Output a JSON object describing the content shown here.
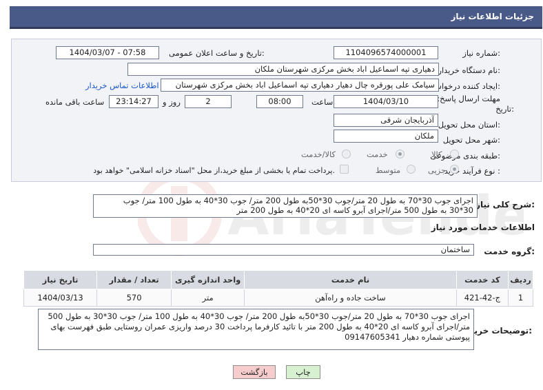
{
  "header": {
    "title": "جزئیات اطلاعات نیاز"
  },
  "form": {
    "need_number": {
      "label": "شماره نیاز:",
      "value": "1104096574000001"
    },
    "announce_datetime": {
      "label": "تاریخ و ساعت اعلان عمومی:",
      "value": "1404/03/07 - 07:58"
    },
    "buyer_org": {
      "label": "نام دستگاه خریدار:",
      "value": "دهیاری تپه اسماعیل اباد بخش مرکزی شهرستان ملکان"
    },
    "requester": {
      "label": "ایجاد کننده درخواست:",
      "value": "سیامک علی پورقره چال دهیار دهیاری تپه اسماعیل اباد بخش مرکزی شهرستان",
      "contact_link": "اطلاعات تماس خریدار"
    },
    "deadline": {
      "label_line1": "مهلت ارسال پاسخ: تا",
      "label_line2": "تاریخ:",
      "date": "1404/03/10",
      "time_label": "ساعت",
      "time": "08:00",
      "days": "2",
      "days_label": "روز و",
      "remaining": "23:14:27",
      "remaining_label": "ساعت باقی مانده"
    },
    "province": {
      "label": "استان محل تحویل:",
      "value": "آذربایجان شرقی"
    },
    "city": {
      "label": "شهر محل تحویل:",
      "value": "ملکان"
    },
    "category": {
      "label": "طبقه بندی موضوعی:",
      "options": [
        "کالا",
        "خدمت",
        "کالا/خدمت"
      ],
      "selected": "خدمت"
    },
    "purchase_type": {
      "label": "نوع فرآیند خرید :",
      "options": [
        "جزیی",
        "متوسط"
      ],
      "selected": "جزیی",
      "treasury_note": "پرداخت تمام یا بخشی از مبلغ خرید،از محل \"اسناد خزانه اسلامی\" خواهد بود."
    }
  },
  "general_description": {
    "label": "شرح کلی نیاز:",
    "text": "اجرای جوب 30*70 به طول 20 متر/جوب 30*50به طول 200 متر/ جوب 30*40 به طول 100 متر/ جوب 30*30 به طول 500 متر/اجرای آبرو کاسه ای 20*40 به طول 200 متر"
  },
  "services": {
    "title": "اطلاعات خدمات مورد نیاز",
    "group_label": "گروه خدمت:",
    "group_value": "ساختمان",
    "columns": [
      "ردیف",
      "کد خدمت",
      "نام خدمت",
      "واحد اندازه گیری",
      "تعداد / مقدار",
      "تاریخ نیاز"
    ],
    "rows": [
      {
        "row": "1",
        "code": "ج-42-421",
        "name": "ساخت جاده و راه‌آهن",
        "unit": "متر",
        "qty": "570",
        "date": "1404/03/13"
      }
    ]
  },
  "buyer_notes": {
    "label": "توضیحات خریدار:",
    "text": "اجرای جوب 30*70 به طول 20 متر/جوب 30*50به طول 200 متر/ جوب 30*40 به طول 100 متر/ جوب 30*30 به طول 500 متر/اجرای آبرو کاسه ای 20*40 به طول 200 متر با تائید کارفرما پرداخت 30 درصد واریزی عمران روستایی طبق فهرست بهای پیوستی شماره دهیار  09147605341"
  },
  "buttons": {
    "print": "چاپ",
    "back": "بازگشت"
  },
  "colors": {
    "header_bg": "#4a5a88",
    "print_btn": "#d6f0d0",
    "back_btn": "#f6cccc",
    "link": "#1a56c8"
  }
}
